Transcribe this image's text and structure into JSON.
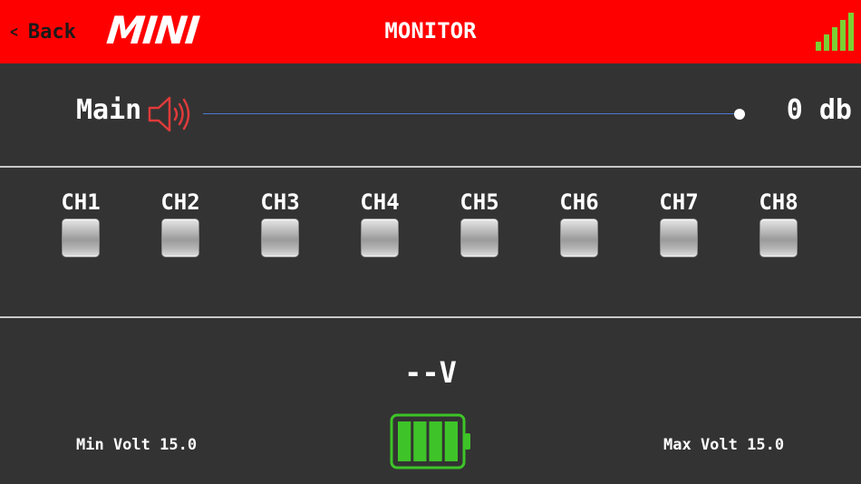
{
  "header": {
    "back_label": "Back",
    "back_icon": "chevron-left-icon",
    "logo_text": "MINI",
    "title": "MONITOR",
    "signal_icon": "signal-strength-icon",
    "signal_bars_lit": 5,
    "signal_bars_total": 5
  },
  "main": {
    "label": "Main",
    "speaker_icon": "speaker-icon",
    "volume_level": 1.0,
    "db_value": "0 db"
  },
  "channels": [
    {
      "label": "CH1"
    },
    {
      "label": "CH2"
    },
    {
      "label": "CH3"
    },
    {
      "label": "CH4"
    },
    {
      "label": "CH5"
    },
    {
      "label": "CH6"
    },
    {
      "label": "CH7"
    },
    {
      "label": "CH8"
    }
  ],
  "power": {
    "voltage": "--V",
    "min_volt": "Min Volt 15.0",
    "max_volt": "Max Volt 15.0",
    "battery_icon": "battery-icon",
    "battery_cells_lit": 4,
    "battery_cells_total": 4
  },
  "colors": {
    "header_bg": "#ff0000",
    "background": "#333333",
    "accent_green": "#3ec428",
    "signal_green": "#7ad133",
    "speaker_red": "#e03a3a",
    "slider_track": "#4a7ad8"
  }
}
